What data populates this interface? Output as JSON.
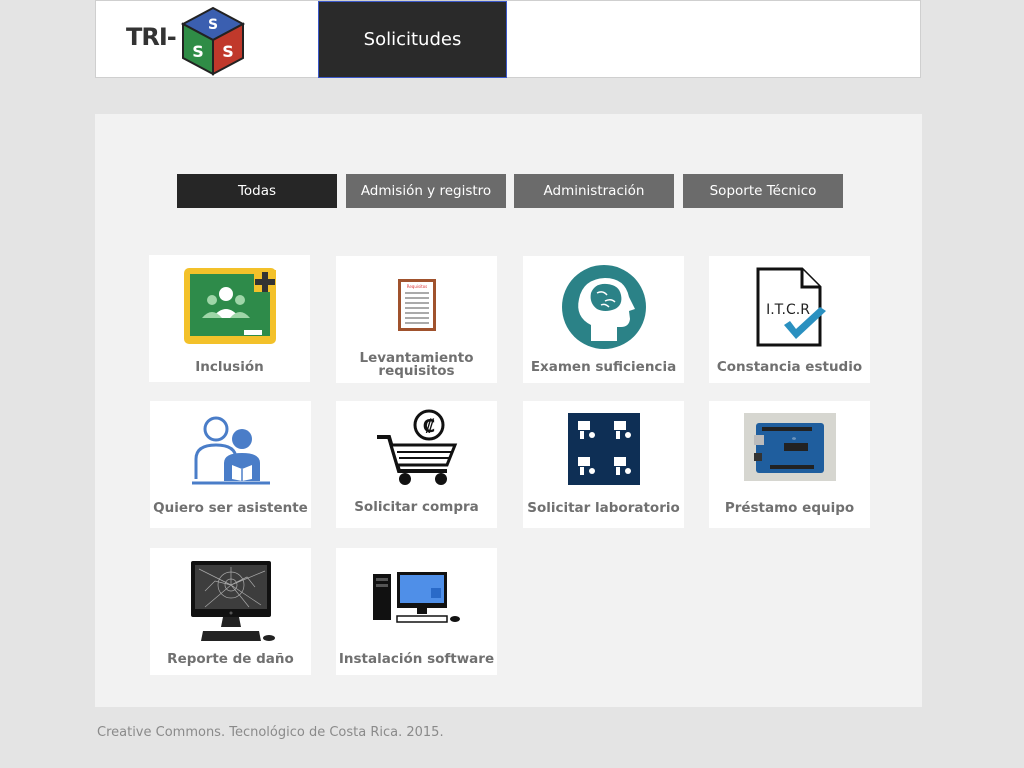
{
  "header": {
    "logo_text": "TRI-",
    "nav_active_label": "Solicitudes"
  },
  "tabs": [
    {
      "label": "Todas",
      "active": true
    },
    {
      "label": "Admisión y registro",
      "active": false
    },
    {
      "label": "Administración",
      "active": false
    },
    {
      "label": "Soporte Técnico",
      "active": false
    }
  ],
  "cards": [
    {
      "label": "Inclusión",
      "icon": "classroom-icon"
    },
    {
      "label": "Levantamiento requisitos",
      "icon": "requirements-doc-icon",
      "doc_title": "Requisitos"
    },
    {
      "label": "Examen suficiencia",
      "icon": "head-brain-icon"
    },
    {
      "label": "Constancia estudio",
      "icon": "itcr-certificate-icon",
      "doc_text": "I.T.C.R"
    },
    {
      "label": "Quiero ser asistente",
      "icon": "assistant-icon"
    },
    {
      "label": "Solicitar compra",
      "icon": "shopping-cart-icon",
      "currency": "₡"
    },
    {
      "label": "Solicitar laboratorio",
      "icon": "lab-icon"
    },
    {
      "label": "Préstamo equipo",
      "icon": "arduino-board-icon"
    },
    {
      "label": "Reporte de daño",
      "icon": "broken-monitor-icon"
    },
    {
      "label": "Instalación software",
      "icon": "desktop-computer-icon"
    }
  ],
  "footer": {
    "text": "Creative Commons. Tecnológico de Costa Rica. 2015."
  },
  "colors": {
    "background": "#e4e4e4",
    "panel": "#f2f2f2",
    "tab": "#6b6b6b",
    "tab_active": "#262626",
    "card_label": "#707070",
    "teal": "#2b8287"
  }
}
